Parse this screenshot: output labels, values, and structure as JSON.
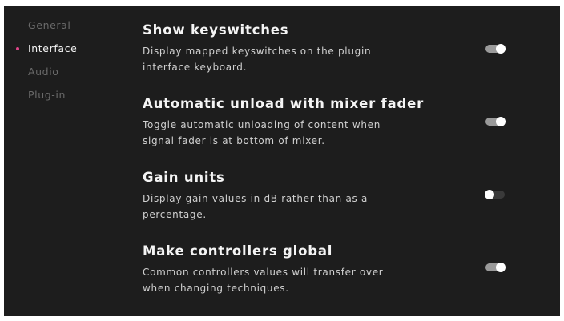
{
  "sidebar": {
    "items": [
      {
        "label": "General",
        "active": false
      },
      {
        "label": "Interface",
        "active": true
      },
      {
        "label": "Audio",
        "active": false
      },
      {
        "label": "Plug-in",
        "active": false
      }
    ]
  },
  "settings": [
    {
      "title": "Show keyswitches",
      "description": "Display mapped keyswitches on the plugin interface keyboard.",
      "enabled": true
    },
    {
      "title": "Automatic unload with mixer fader",
      "description": "Toggle automatic unloading of content when signal fader is at bottom of mixer.",
      "enabled": true
    },
    {
      "title": "Gain units",
      "description": "Display gain values in dB rather than as a percentage.",
      "enabled": false
    },
    {
      "title": "Make controllers global",
      "description": "Common controllers values will transfer over when changing techniques.",
      "enabled": true
    }
  ],
  "colors": {
    "background": "#1d1d1d",
    "accent": "#e0468a",
    "toggle_on": "#9a9a9a",
    "toggle_off": "#3a3a3a"
  }
}
